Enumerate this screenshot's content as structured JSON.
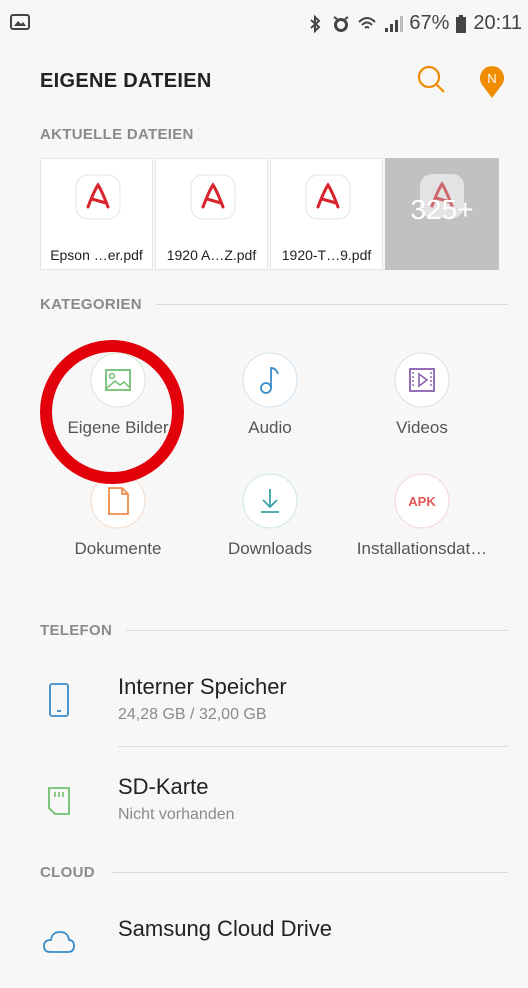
{
  "status": {
    "battery": "67%",
    "time": "20:11"
  },
  "appbar": {
    "title": "EIGENE DATEIEN",
    "avatar_letter": "N"
  },
  "recent": {
    "label": "AKTUELLE DATEIEN",
    "files": [
      "Epson …er.pdf",
      "1920 A…Z.pdf",
      "1920-T…9.pdf"
    ],
    "more": "325+"
  },
  "categories": {
    "label": "KATEGORIEN",
    "items": [
      "Eigene Bilder",
      "Audio",
      "Videos",
      "Dokumente",
      "Downloads",
      "Installationsdat…"
    ],
    "apk_text": "APK"
  },
  "phone": {
    "label": "TELEFON",
    "items": [
      {
        "name": "Interner Speicher",
        "sub": "24,28 GB / 32,00 GB"
      },
      {
        "name": "SD-Karte",
        "sub": "Nicht vorhanden"
      }
    ]
  },
  "cloud": {
    "label": "CLOUD",
    "items": [
      {
        "name": "Samsung Cloud Drive"
      }
    ]
  },
  "colors": {
    "pdf_red": "#d7232b",
    "images_green": "#6fbf6f",
    "audio_blue": "#3a8cc8",
    "video_purple": "#8a5fb0",
    "docs_orange": "#f08a4b",
    "download_teal": "#3ba0a8",
    "apk_red": "#e45757",
    "accent_orange": "#f08c00",
    "annotation_red": "#e2000b"
  }
}
